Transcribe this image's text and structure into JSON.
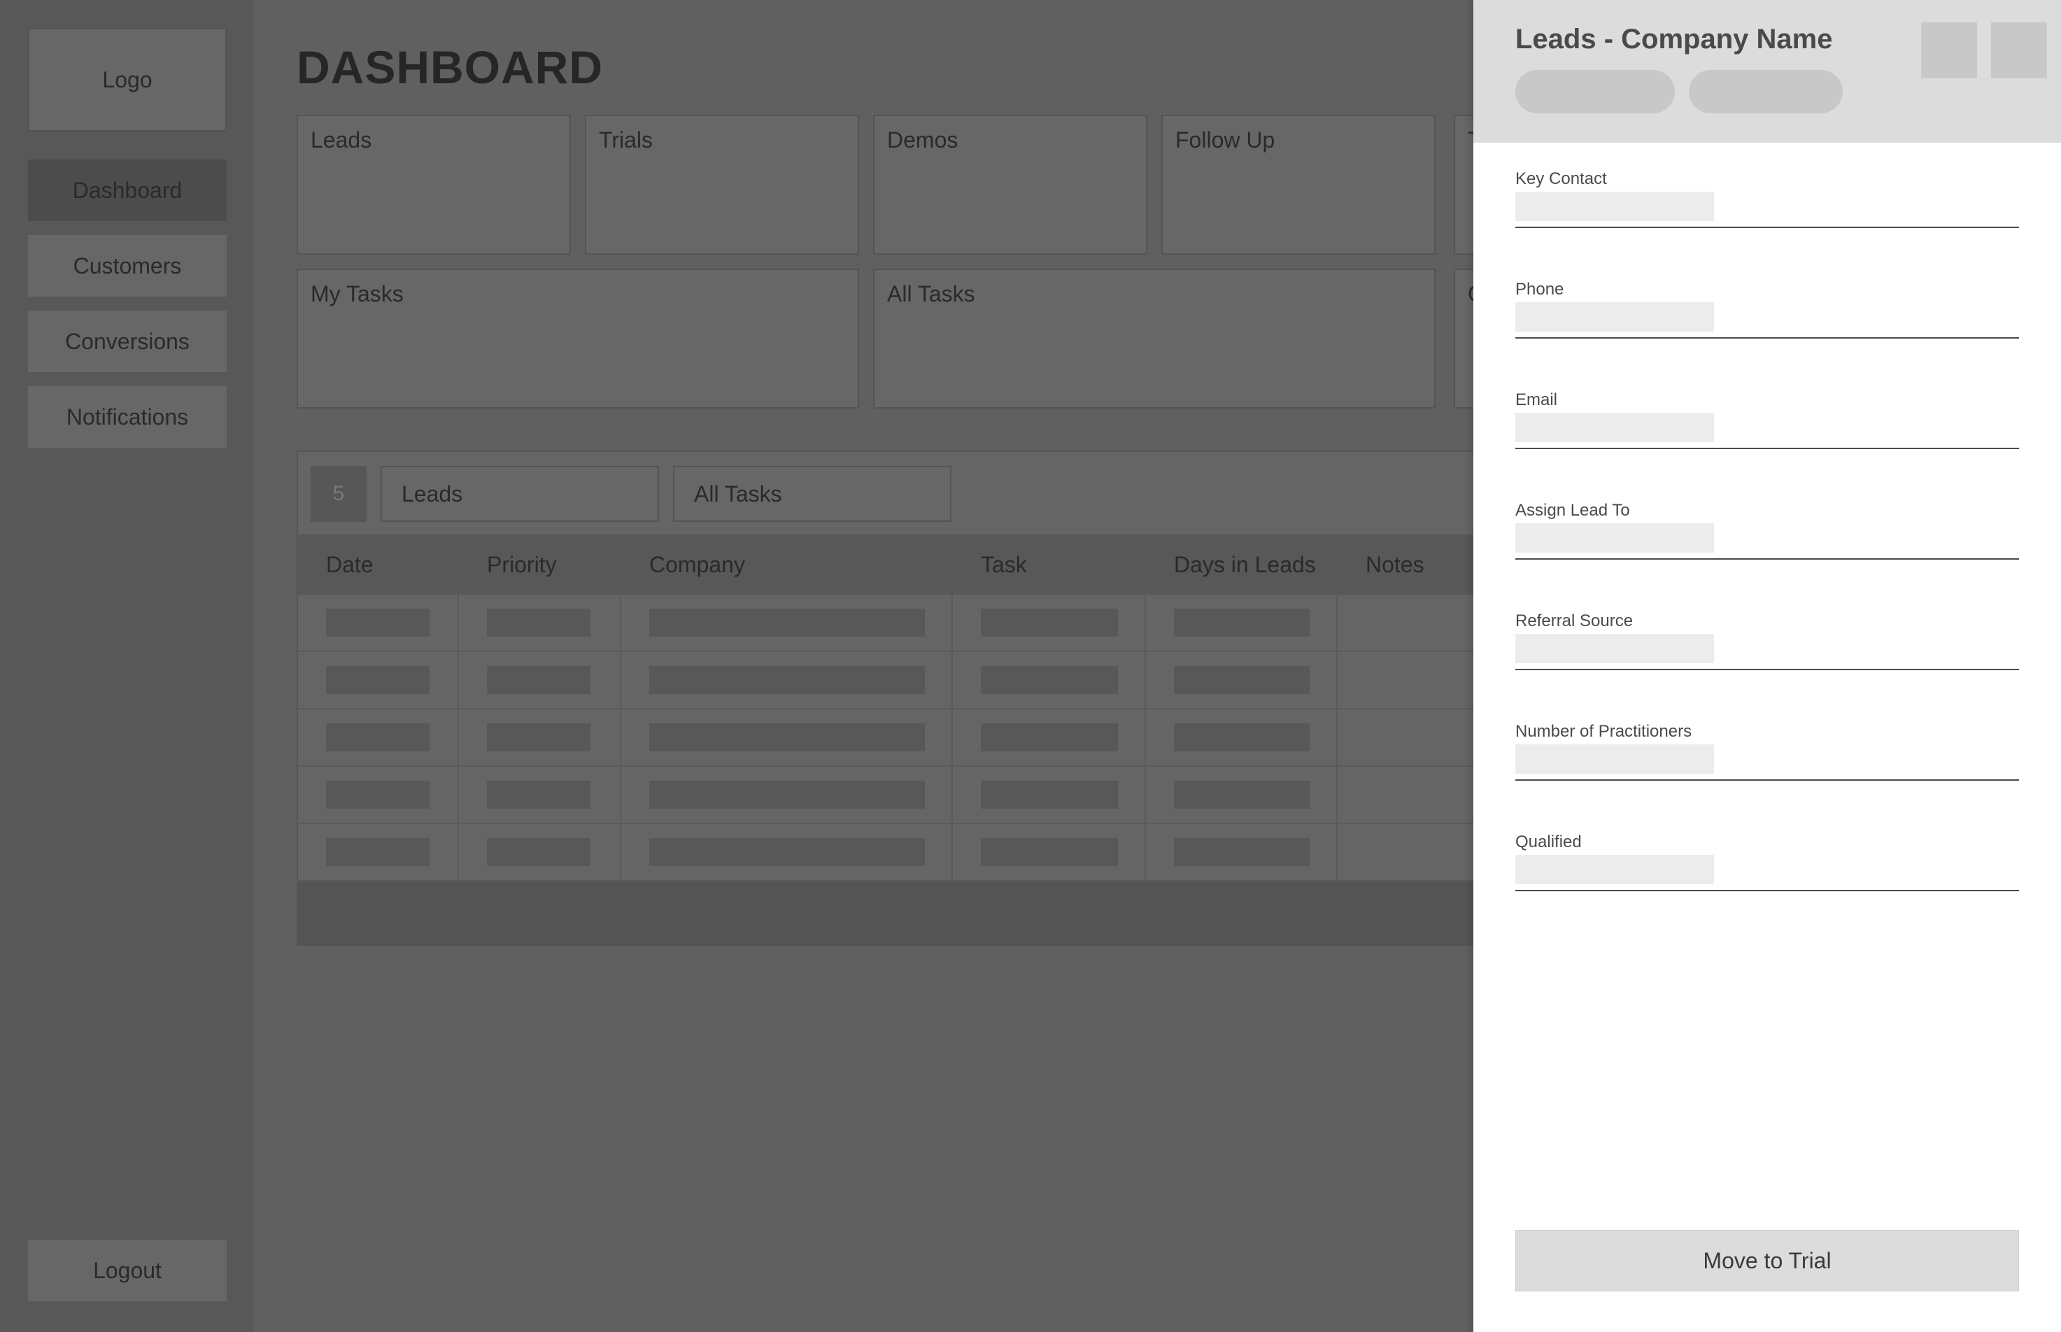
{
  "sidebar": {
    "logo": "Logo",
    "items": [
      {
        "label": "Dashboard",
        "active": true
      },
      {
        "label": "Customers"
      },
      {
        "label": "Conversions"
      },
      {
        "label": "Notifications"
      }
    ],
    "logout": "Logout"
  },
  "main": {
    "title": "DASHBOARD",
    "stat_cards": [
      "Leads",
      "Trials",
      "Demos",
      "Follow Up",
      "T"
    ],
    "task_cards": [
      "My Tasks",
      "All Tasks",
      "C"
    ]
  },
  "table_panel": {
    "count": "5",
    "filter_1": "Leads",
    "filter_2": "All Tasks",
    "columns": [
      "Date",
      "Priority",
      "Company",
      "Task",
      "Days in Leads",
      "Notes"
    ],
    "row_count": 5
  },
  "drawer": {
    "title": "Leads - Company Name",
    "fields": [
      {
        "label": "Key Contact"
      },
      {
        "label": "Phone"
      },
      {
        "label": "Email"
      },
      {
        "label": "Assign Lead To"
      },
      {
        "label": "Referral Source"
      },
      {
        "label": "Number of Practitioners"
      },
      {
        "label": "Qualified"
      }
    ],
    "action": "Move to Trial"
  }
}
